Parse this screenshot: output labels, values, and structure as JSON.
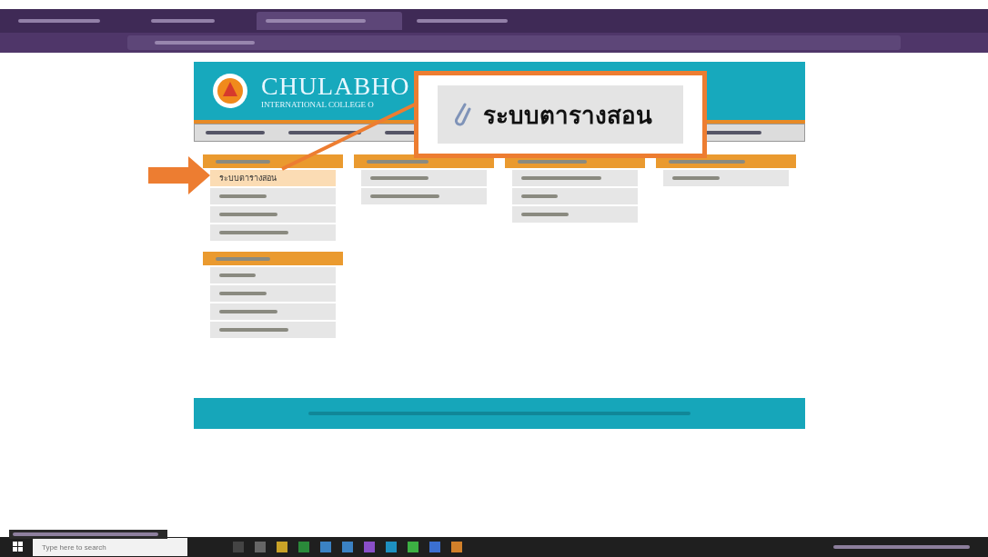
{
  "browser": {
    "tabs": [
      {
        "selected": false
      },
      {
        "selected": false
      },
      {
        "selected": true
      },
      {
        "selected": false
      }
    ]
  },
  "site": {
    "logo_title": "CHULABHO",
    "logo_subtitle": "INTERNATIONAL COLLEGE O"
  },
  "columns": [
    {
      "panels": [
        {
          "items": [
            {
              "text": "ระบบตารางสอน",
              "selected": true
            },
            {
              "selected": false
            },
            {
              "selected": false
            },
            {
              "selected": false
            }
          ]
        },
        {
          "items": [
            {
              "selected": false
            },
            {
              "selected": false
            },
            {
              "selected": false
            },
            {
              "selected": false
            }
          ]
        }
      ]
    },
    {
      "panels": [
        {
          "items": [
            {
              "selected": false
            },
            {
              "selected": false
            }
          ]
        }
      ]
    },
    {
      "panels": [
        {
          "items": [
            {
              "selected": false
            },
            {
              "selected": false
            },
            {
              "selected": false
            }
          ]
        }
      ]
    },
    {
      "panels": [
        {
          "items": [
            {
              "selected": false
            }
          ]
        }
      ]
    }
  ],
  "callout": {
    "text": "ระบบตารางสอน"
  },
  "taskbar": {
    "search_placeholder": "Type here to search"
  }
}
